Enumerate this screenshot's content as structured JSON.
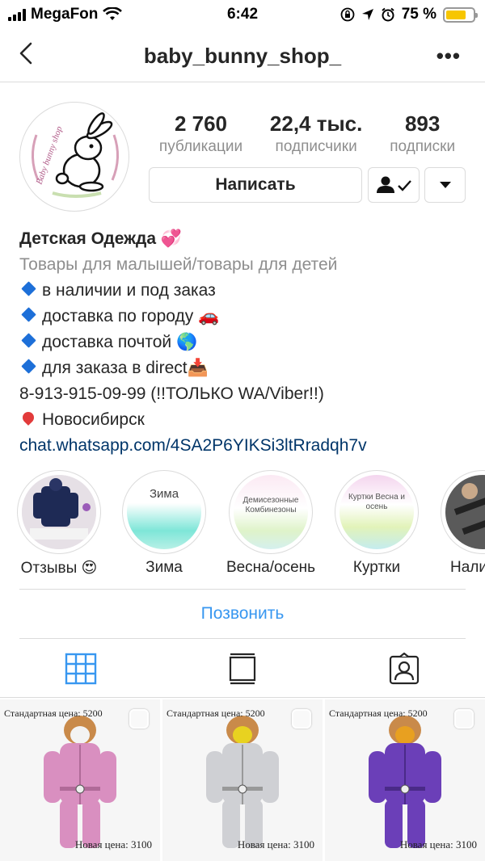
{
  "status_bar": {
    "carrier": "MegaFon",
    "time": "6:42",
    "battery_percent": "75 %",
    "battery_level": 0.75,
    "icons": [
      "signal-icon",
      "wifi-icon",
      "lock-rotation-icon",
      "location-icon",
      "alarm-icon",
      "battery-icon"
    ]
  },
  "nav": {
    "title": "baby_bunny_shop_",
    "more": "•••"
  },
  "stats": [
    {
      "num": "2 760",
      "label": "публикации"
    },
    {
      "num": "22,4 тыс.",
      "label": "подписчики"
    },
    {
      "num": "893",
      "label": "подписки"
    }
  ],
  "actions": {
    "message": "Написать"
  },
  "bio": {
    "name": "Детская Одежда 💞",
    "category": "Товары для малышей/товары для детей",
    "lines": [
      "в наличии и под заказ",
      "доставка по городу 🚗",
      "доставка почтой 🌎",
      "для заказа в direct📥"
    ],
    "phone": "8-913-915-09-99 (!!ТОЛЬКО WA/Viber!!)",
    "location": "Новосибирск",
    "link": "chat.whatsapp.com/4SA2P6YIKSi3ltRradqh7v"
  },
  "highlights": [
    {
      "caption": "Отзывы 😍",
      "inner": ""
    },
    {
      "caption": "Зима",
      "inner": "Зима"
    },
    {
      "caption": "Весна/осень",
      "inner": "Демисезонные Комбинезоны"
    },
    {
      "caption": "Куртки",
      "inner": "Куртки Весна и осень"
    },
    {
      "caption": "Нали",
      "inner": ""
    }
  ],
  "call": "Позвонить",
  "posts": [
    {
      "old_price": "Стандартная цена: 5200",
      "new_price": "Новая цена: 3100",
      "color": "#d98fc0"
    },
    {
      "old_price": "Стандартная цена: 5200",
      "new_price": "Новая цена: 3100",
      "color": "#cfd0d4"
    },
    {
      "old_price": "Стандартная цена: 5200",
      "new_price": "Новая цена: 3100",
      "color": "#6b3fb8"
    }
  ]
}
